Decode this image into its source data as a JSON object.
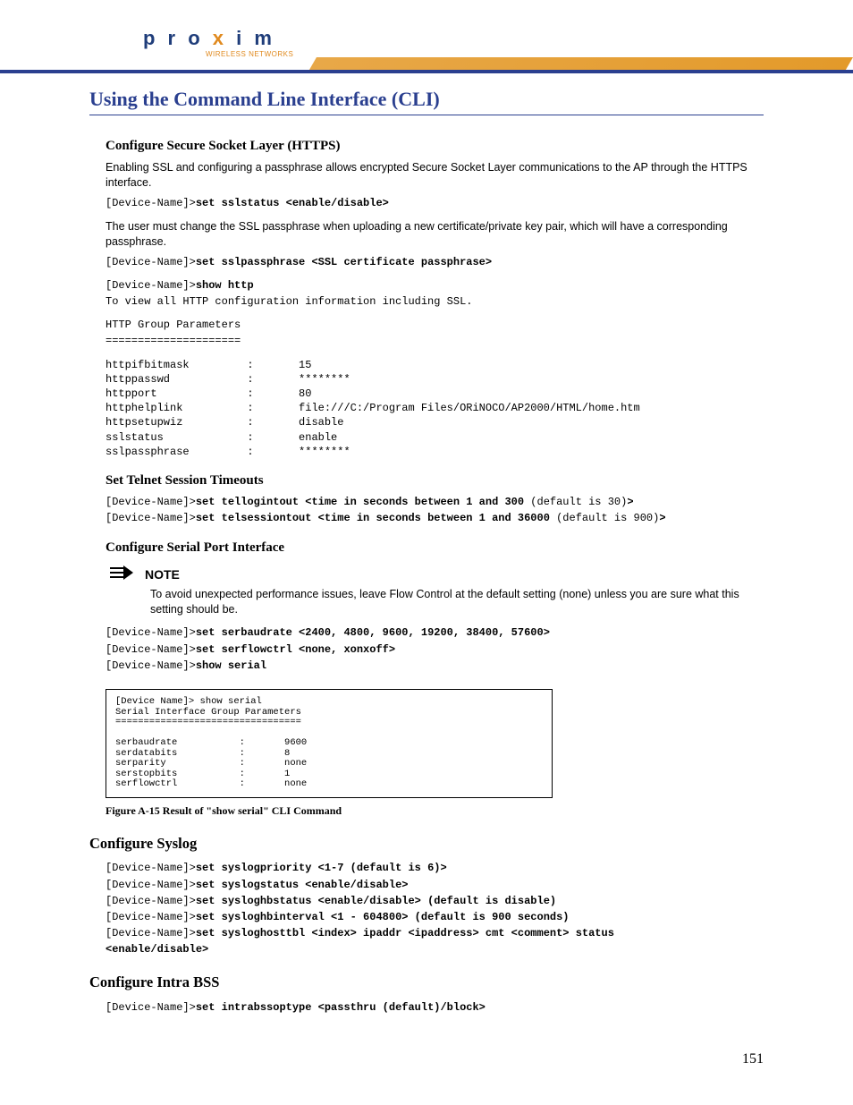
{
  "logo": {
    "brand_pre": "p r o ",
    "brand_x": "x",
    "brand_post": " i m",
    "tagline": "WIRELESS NETWORKS"
  },
  "title": "Using the Command Line Interface (CLI)",
  "https": {
    "heading": "Configure Secure Socket Layer (HTTPS)",
    "intro": "Enabling SSL and configuring a passphrase allows encrypted Secure Socket Layer communications to the AP through the HTTPS interface.",
    "cli1_prompt": "[Device-Name]>",
    "cli1_cmd": "set sslstatus <enable/disable>",
    "note_passphrase": "The user must change the SSL passphrase when  uploading a new certificate/private key pair, which will have a corresponding passphrase.",
    "cli2_prompt": "[Device-Name]>",
    "cli2_cmd": "set sslpassphrase <SSL certificate passphrase>",
    "cli3_prompt": "[Device-Name]>",
    "cli3_cmd": "show http",
    "cli3_desc": "To view all HTTP configuration information including SSL.",
    "params_header": "HTTP Group Parameters",
    "params_divider": "=====================",
    "params": "httpifbitmask         :       15\nhttppasswd            :       ********\nhttpport              :       80\nhttphelplink          :       file:///C:/Program Files/ORiNOCO/AP2000/HTML/home.htm\nhttpsetupwiz          :       disable\nsslstatus             :       enable\nsslpassphrase         :       ********"
  },
  "telnet": {
    "heading": "Set Telnet Session Timeouts",
    "cli1_prompt": "[Device-Name]>",
    "cli1_cmd": "set tellogintout <time in seconds between 1 and 300 ",
    "cli1_tail": "(default is 30)",
    "cli1_end": ">",
    "cli2_prompt": "[Device-Name]>",
    "cli2_cmd": "set telsessiontout <time in seconds between 1 and 36000 ",
    "cli2_tail": "(default is 900)",
    "cli2_end": ">"
  },
  "serial": {
    "heading": "Configure Serial Port Interface",
    "note_label": "NOTE",
    "note_body": "To avoid unexpected performance issues, leave Flow Control at the default setting (none) unless you are sure what this setting should be.",
    "cli1_prompt": "[Device-Name]>",
    "cli1_cmd": "set serbaudrate <2400, 4800, 9600, 19200, 38400, 57600>",
    "cli2_prompt": "[Device-Name]>",
    "cli2_cmd": "set serflowctrl <none, xonxoff>",
    "cli3_prompt": "[Device-Name]>",
    "cli3_cmd": "show serial",
    "figure_text": "[Device Name]> show serial\nSerial Interface Group Parameters\n=================================\n\nserbaudrate           :       9600\nserdatabits           :       8\nserparity             :       none\nserstopbits           :       1\nserflowctrl           :       none",
    "figure_caption": "Figure A-15   Result of \"show serial\" CLI Command"
  },
  "syslog": {
    "heading": "Configure Syslog",
    "l1_prompt": "[Device-Name]>",
    "l1_cmd": "set syslogpriority <1-7 (default is 6)>",
    "l2_prompt": "[Device-Name]>",
    "l2_cmd": "set syslogstatus <enable/disable>",
    "l3_prompt": "[Device-Name]>",
    "l3_cmd": "set sysloghbstatus <enable/disable> (default is disable)",
    "l4_prompt": "[Device-Name]>",
    "l4_cmd": "set sysloghbinterval <1 - 604800> (default is 900 seconds)",
    "l5_prompt": "[Device-Name]>",
    "l5_cmd": "set sysloghosttbl <index> ipaddr <ipaddress> cmt <comment> status ",
    "l5_cont": "<enable/disable>"
  },
  "intrabss": {
    "heading": "Configure Intra BSS",
    "cli_prompt": "[Device-Name]>",
    "cli_cmd": "set intrabssoptype <passthru (default)/block>"
  },
  "page_number": "151"
}
